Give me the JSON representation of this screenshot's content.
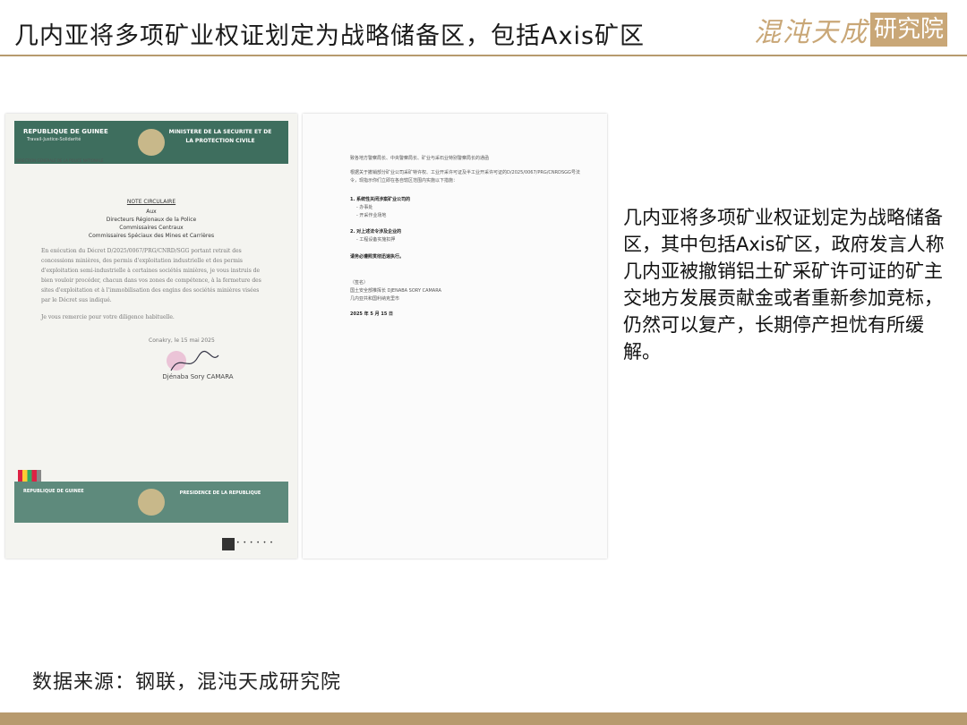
{
  "header": {
    "title": "几内亚将多项矿业权证划定为战略储备区，包括Axis矿区",
    "logo_script": "混沌天成",
    "logo_box": "研究院"
  },
  "doc_left": {
    "band_top_left": "REPUBLIQUE DE GUINEE",
    "band_top_left_sub": "Travail-Justice-Solidarité",
    "band_top_right": "MINISTERE DE LA SECURITE ET DE LA PROTECTION CIVILE",
    "direction": "DIRECTION GENERALE DE LA POLICE NATIONALE",
    "note_title": "NOTE CIRCULAIRE",
    "aux": "Aux",
    "recipients": [
      "Directeurs Régionaux de la Police",
      "Commissaires Centraux",
      "Commissaires Spéciaux des Mines et Carrières"
    ],
    "paragraph_1": "En exécution du Décret D/2025/0067/PRG/CNRD/SGG portant retrait des concessions minières, des permis d'exploitation industrielle et des permis d'exploitation semi-industrielle à certaines sociétés minières, je vous instruis de bien vouloir procéder, chacun dans vos zones de compétence, à la fermeture des sites d'exploitation et à l'immobilisation des engins des sociétés minières visées par le Décret sus indiqué.",
    "paragraph_2": "Je vous remercie pour votre diligence habituelle.",
    "city_date": "Conakry, le 15 mai 2025",
    "signatory": "Djénaba Sory CAMARA",
    "band_bottom_left": "REPUBLIQUE DE GUINEE",
    "band_bottom_right": "PRESIDENCE DE LA REPUBLIQUE",
    "dots": "• • • • • •"
  },
  "doc_right": {
    "line_1": "致各地方警察局长、中央警察局长、矿业与采石业特别警察局长的通函",
    "line_2": "根据关于撤销部分矿业公司采矿特许权、工业开采许可证及半工业开采许可证的D/2025/0067/PRG/CNRDSGG号法令，现指示你们立即在各自辖区范围内实施以下措施：",
    "item_1": "1. 系统性关闭涉案矿业公司的",
    "item_1a": "- 办事处",
    "item_1b": "- 开采作业场地",
    "item_2": "2. 对上述法令涉及企业的",
    "item_2a": "- 工程设备实施扣押",
    "instruction": "请务必遵照贯彻迅速执行。",
    "sign_label": "（签名）",
    "signatory": "国土安全部推挥长 DJENABA SORY CAMARA",
    "signatory_title": "几内亚共和国利纳克里市",
    "date": "2025 年 5 月 15 日"
  },
  "note": "几内亚将多项矿业权证划定为战略储备区，其中包括Axis矿区，政府发言人称几内亚被撤销铝土矿采矿许可证的矿主交地方发展贡献金或者重新参加竞标，仍然可以复产，长期停产担忧有所缓解。",
  "source": "数据来源：钢联，混沌天成研究院",
  "colors": {
    "accent": "#b79a6e",
    "band": "#3e6e5e"
  }
}
